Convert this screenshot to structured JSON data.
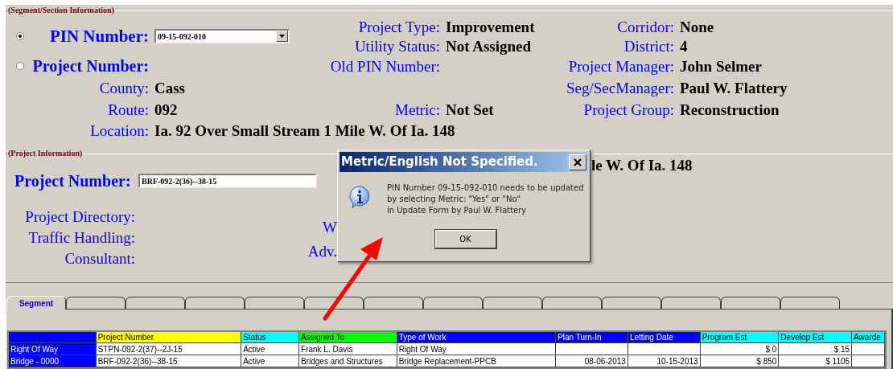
{
  "segment_section": {
    "title": "(Segment/Section Information)",
    "pin_number": {
      "label": "PIN Number:",
      "value": "09-15-092-010",
      "selected": true
    },
    "project_number": {
      "label": "Project Number:",
      "selected": false
    },
    "project_type": {
      "label": "Project Type:",
      "value": "Improvement"
    },
    "utility_status": {
      "label": "Utility Status:",
      "value": "Not Assigned"
    },
    "old_pin_number": {
      "label": "Old PIN Number:"
    },
    "corridor": {
      "label": "Corridor:",
      "value": "None"
    },
    "district": {
      "label": "District:",
      "value": "4"
    },
    "project_manager": {
      "label": "Project Manager:",
      "value": "John Selmer"
    },
    "seg_sec_manager": {
      "label": "Seg/SecManager:",
      "value": "Paul W. Flattery"
    },
    "county": {
      "label": "County:",
      "value": "Cass"
    },
    "route": {
      "label": "Route:",
      "value": "092"
    },
    "metric": {
      "label": "Metric:",
      "value": "Not Set"
    },
    "project_group": {
      "label": "Project Group:",
      "value": "Reconstruction"
    },
    "location": {
      "label": "Location:",
      "value": "Ia. 92 Over Small Stream 1 Mile W. Of Ia. 148"
    }
  },
  "project_section": {
    "title": "(Project Information)",
    "location_partial": "le W. Of Ia. 148",
    "project_number": {
      "label": "Project Number:",
      "value": "BRF-092-2(36)--38-15"
    },
    "labels": [
      "Project Directory:",
      "Traffic Handling:",
      "Consultant:"
    ],
    "partial_labels": [
      "W",
      "Adv."
    ]
  },
  "tabs": [
    {
      "label": "Segment",
      "selected": true
    },
    {
      "selected": false
    },
    {
      "selected": false
    },
    {
      "selected": false
    },
    {
      "selected": false
    },
    {
      "selected": false
    },
    {
      "selected": false
    },
    {
      "selected": false
    },
    {
      "selected": false
    },
    {
      "selected": false
    },
    {
      "selected": false
    },
    {
      "selected": false
    },
    {
      "selected": false
    },
    {
      "selected": false
    }
  ],
  "table": {
    "columns": [
      {
        "color": "#0000ff"
      },
      {
        "label": "Project Number",
        "color": "#ffff00"
      },
      {
        "label": "Status",
        "color": "#00ffff"
      },
      {
        "label": "Assigned To",
        "color": "#00ff00"
      },
      {
        "label": "Type of Work",
        "color": "#0000ff"
      },
      {
        "label": "Plan Turn-In",
        "color": "#0000ff"
      },
      {
        "label": "Letting Date",
        "color": "#0000ff"
      },
      {
        "label": "Program Est",
        "color": "#00ffff"
      },
      {
        "label": "Develop Est",
        "color": "#00ffff"
      },
      {
        "label": "Awarde",
        "color": "#00ffff"
      }
    ],
    "rows": [
      {
        "cells": [
          "Right Of Way",
          "STPN-092-2(37)--2J-15",
          "Active",
          "Frank L. Davis",
          "Right Of Way",
          "",
          "",
          "$ 0",
          "$ 15",
          ""
        ]
      },
      {
        "cells": [
          "Bridge - 0000",
          "BRF-092-2(36)--38-15",
          "Active",
          "Bridges and Structures",
          "Bridge Replacement-PPCB",
          "08-06-2013",
          "10-15-2013",
          "$ 850",
          "$ 1105",
          ""
        ]
      }
    ]
  },
  "dialog": {
    "title": "Metric/English Not Specified.",
    "message": [
      "PIN Number 09-15-092-010 needs to be updated",
      "by selecting Metric: \"Yes\" or \"No\"",
      "in Update Form by Paul W. Flattery"
    ],
    "ok": "OK"
  }
}
